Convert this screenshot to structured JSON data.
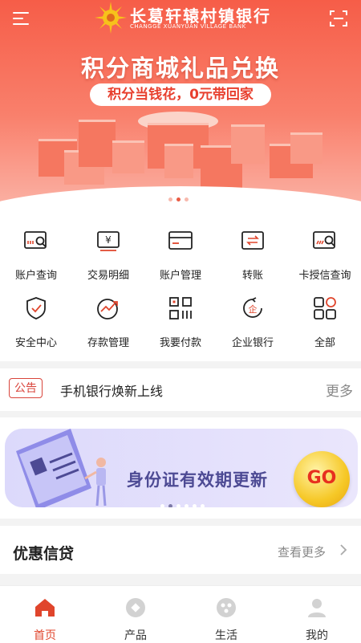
{
  "header": {
    "bank_name": "长葛轩辕村镇银行",
    "bank_name_en": "CHANGGE XUANYUAN VILLAGE BANK"
  },
  "banner": {
    "title": "积分商城礼品兑换",
    "subtitle": "积分当钱花，0元带回家"
  },
  "quick_actions": [
    {
      "label": "账户查询",
      "icon": "account-query-icon"
    },
    {
      "label": "交易明细",
      "icon": "transaction-detail-icon"
    },
    {
      "label": "账户管理",
      "icon": "account-manage-icon"
    },
    {
      "label": "转账",
      "icon": "transfer-icon"
    },
    {
      "label": "卡授信查询",
      "icon": "card-credit-icon"
    },
    {
      "label": "安全中心",
      "icon": "shield-icon"
    },
    {
      "label": "存款管理",
      "icon": "deposit-chart-icon"
    },
    {
      "label": "我要付款",
      "icon": "qr-pay-icon"
    },
    {
      "label": "企业银行",
      "icon": "enterprise-icon"
    },
    {
      "label": "全部",
      "icon": "grid-all-icon"
    }
  ],
  "notice": {
    "tag": "公告",
    "text": "手机银行焕新上线",
    "more": "更多"
  },
  "promo_card": {
    "title": "身份证有效期更新",
    "go": "GO"
  },
  "loan_section": {
    "title": "优惠信贷",
    "more": "查看更多"
  },
  "tabbar": [
    {
      "label": "首页",
      "icon": "home-icon",
      "active": true
    },
    {
      "label": "产品",
      "icon": "product-icon",
      "active": false
    },
    {
      "label": "生活",
      "icon": "life-icon",
      "active": false
    },
    {
      "label": "我的",
      "icon": "user-icon",
      "active": false
    }
  ],
  "colors": {
    "accent": "#e0452c",
    "banner_top": "#f65d48",
    "card_text": "#4d4a94"
  }
}
